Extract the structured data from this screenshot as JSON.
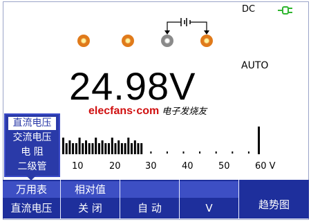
{
  "status": {
    "coupling": "DC",
    "power_icon": "plug-icon",
    "range_mode": "AUTO"
  },
  "jacks": [
    "orange",
    "orange",
    "gray",
    "orange"
  ],
  "reading": {
    "value": "24.98V"
  },
  "watermark": {
    "latin": "elecfans·com",
    "cn": "电子发烧友"
  },
  "mode_menu": {
    "items": [
      "直流电压",
      "交流电压",
      "电 阻",
      "二级管"
    ],
    "selected_index": 0
  },
  "bar_scale": {
    "labels": [
      "10",
      "20",
      "30",
      "40",
      "50",
      "60 V"
    ],
    "value": 24.98,
    "max": 60
  },
  "softkeys": [
    {
      "top": "万用表",
      "bottom": "直流电压"
    },
    {
      "top": "相对值",
      "bottom": "关 闭"
    },
    {
      "top": "",
      "bottom": "自 动"
    },
    {
      "top": "",
      "bottom": "V"
    },
    {
      "top": "",
      "bottom": "趋势图"
    }
  ],
  "colors": {
    "menu_blue": "#2a3aa8",
    "jack_orange": "#e07a1a",
    "jack_gray": "#8a8a8a",
    "watermark_red": "#d01010",
    "plug_green": "#2fb52f"
  }
}
